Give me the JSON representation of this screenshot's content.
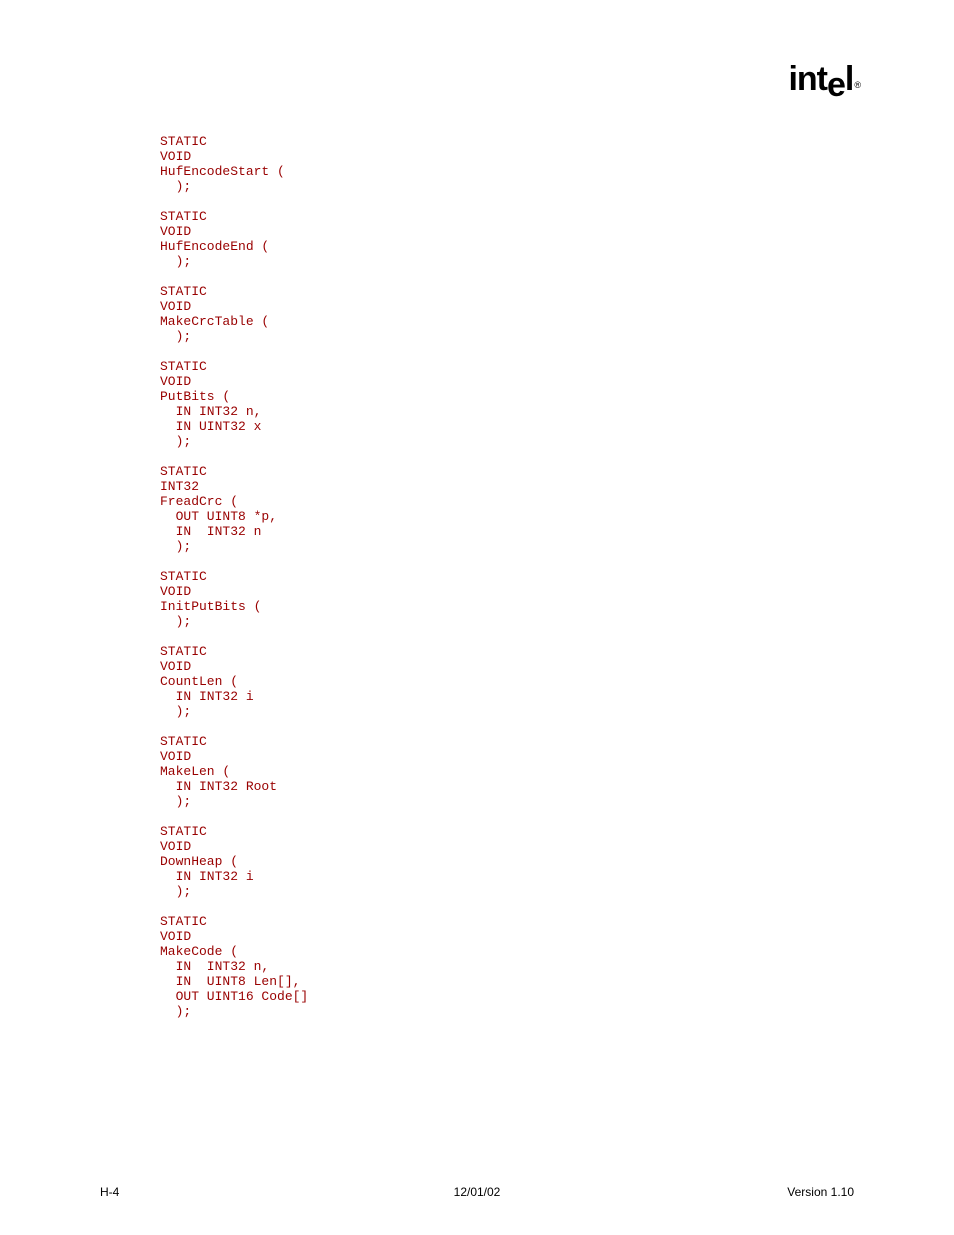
{
  "logo": {
    "text_pre": "int",
    "text_drop": "e",
    "text_post": "l",
    "reg": "®"
  },
  "code": "STATIC\nVOID\nHufEncodeStart (\n  );\n\nSTATIC\nVOID\nHufEncodeEnd (\n  );\n\nSTATIC\nVOID\nMakeCrcTable (\n  );\n\nSTATIC\nVOID\nPutBits (\n  IN INT32 n,\n  IN UINT32 x\n  );\n\nSTATIC\nINT32\nFreadCrc (\n  OUT UINT8 *p,\n  IN  INT32 n\n  );\n\nSTATIC\nVOID\nInitPutBits (\n  );\n\nSTATIC\nVOID\nCountLen (\n  IN INT32 i\n  );\n\nSTATIC\nVOID\nMakeLen (\n  IN INT32 Root\n  );\n\nSTATIC\nVOID\nDownHeap (\n  IN INT32 i\n  );\n\nSTATIC\nVOID\nMakeCode (\n  IN  INT32 n,\n  IN  UINT8 Len[],\n  OUT UINT16 Code[]\n  );",
  "footer": {
    "left": "H-4",
    "center": "12/01/02",
    "right": "Version 1.10"
  }
}
